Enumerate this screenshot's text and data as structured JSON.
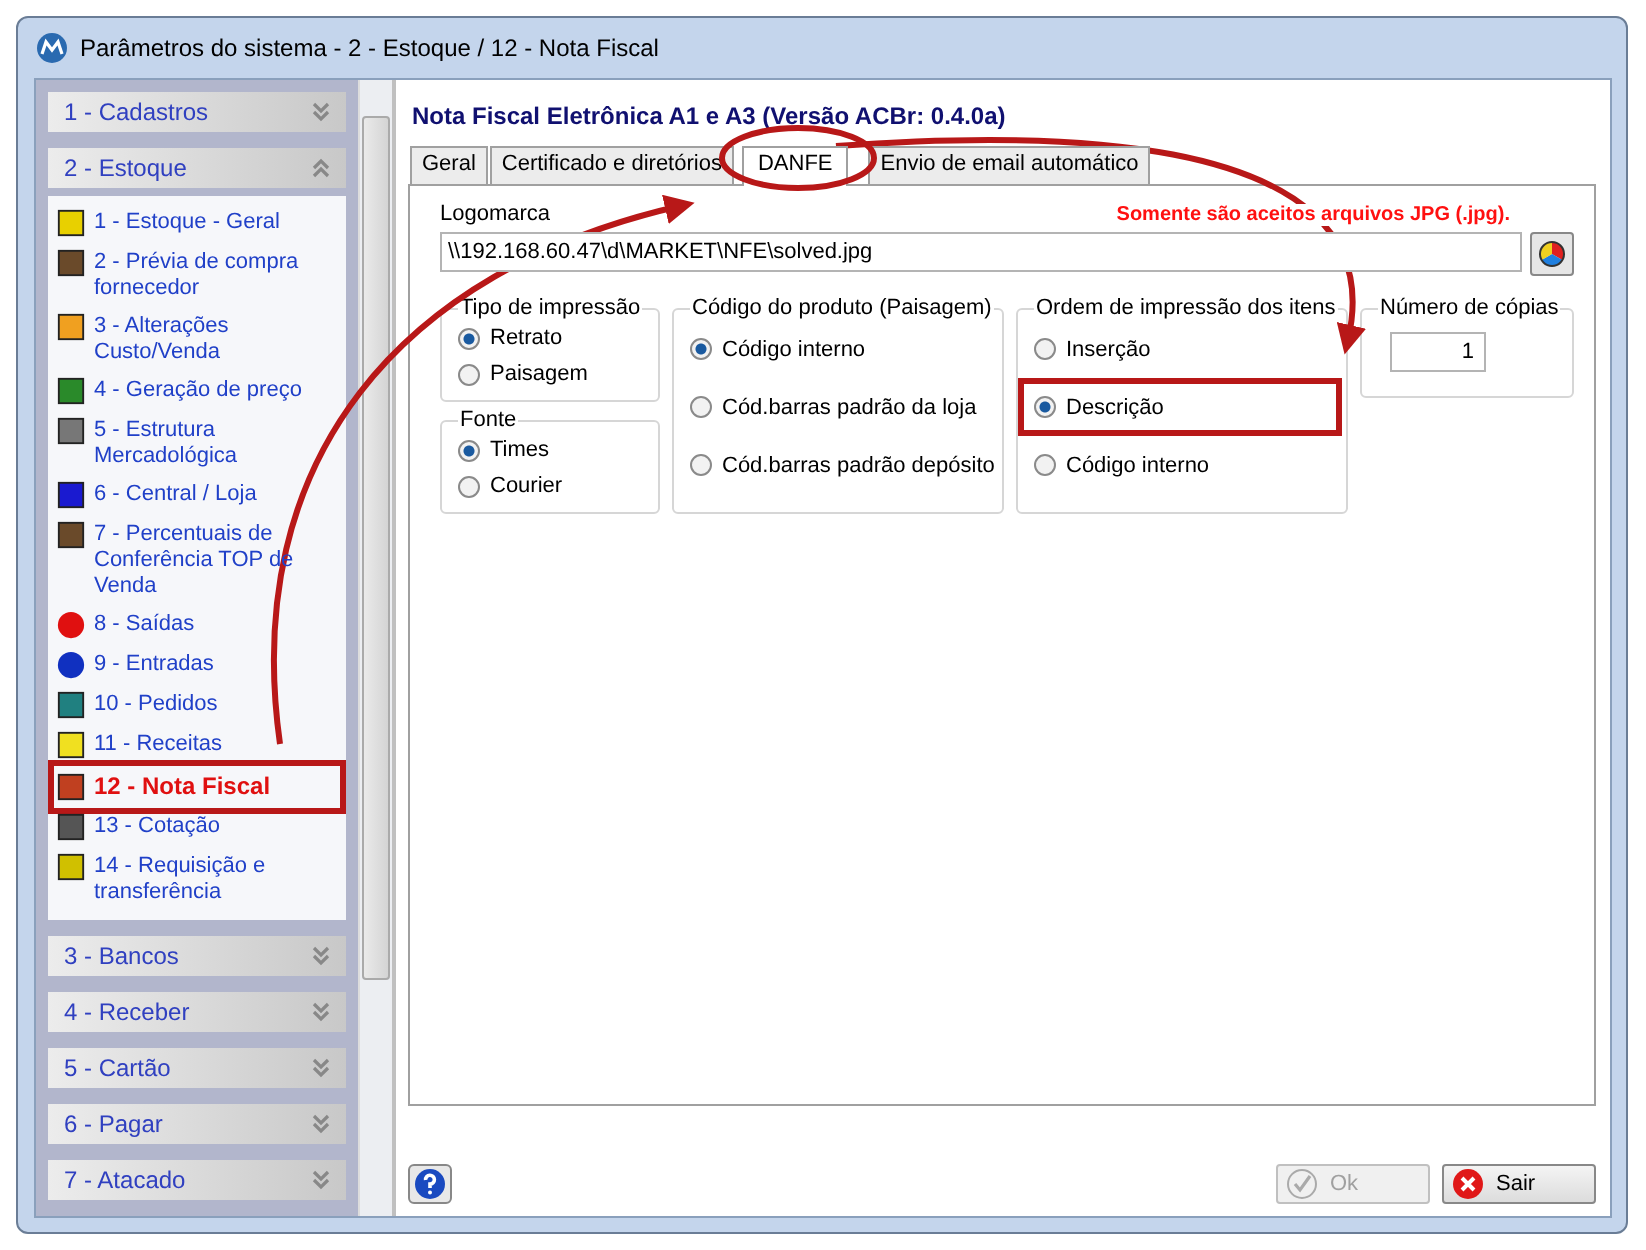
{
  "window": {
    "title": "Parâmetros do sistema - 2 - Estoque / 12 - Nota Fiscal"
  },
  "sidebar": {
    "groups": [
      {
        "label": "1 - Cadastros",
        "expanded": false
      },
      {
        "label": "2 - Estoque",
        "expanded": true,
        "items": [
          {
            "label": "1 - Estoque - Geral",
            "selected": false
          },
          {
            "label": "2 - Prévia de compra fornecedor",
            "selected": false
          },
          {
            "label": "3 - Alterações Custo/Venda",
            "selected": false
          },
          {
            "label": "4 - Geração de preço",
            "selected": false
          },
          {
            "label": "5 - Estrutura Mercadológica",
            "selected": false
          },
          {
            "label": "6 - Central / Loja",
            "selected": false
          },
          {
            "label": "7 - Percentuais de Conferência TOP de Venda",
            "selected": false
          },
          {
            "label": "8 - Saídas",
            "selected": false
          },
          {
            "label": "9 - Entradas",
            "selected": false
          },
          {
            "label": "10 - Pedidos",
            "selected": false
          },
          {
            "label": "11 - Receitas",
            "selected": false
          },
          {
            "label": "12 - Nota Fiscal",
            "selected": true
          },
          {
            "label": "13 - Cotação",
            "selected": false
          },
          {
            "label": "14 - Requisição e transferência",
            "selected": false
          }
        ]
      },
      {
        "label": "3 - Bancos",
        "expanded": false
      },
      {
        "label": "4 - Receber",
        "expanded": false
      },
      {
        "label": "5 - Cartão",
        "expanded": false
      },
      {
        "label": "6 - Pagar",
        "expanded": false
      },
      {
        "label": "7 - Atacado",
        "expanded": false
      }
    ]
  },
  "heading": "Nota Fiscal Eletrônica A1 e A3 (Versão ACBr: 0.4.0a)",
  "tabs": [
    {
      "label": "Geral",
      "selected": false
    },
    {
      "label": "Certificado e diretórios",
      "selected": false
    },
    {
      "label": "DANFE",
      "selected": true
    },
    {
      "label": "Envio de email automático",
      "selected": false
    }
  ],
  "logo": {
    "label": "Logomarca",
    "note": "Somente são aceitos arquivos JPG (.jpg).",
    "value": "\\\\192.168.60.47\\d\\MARKET\\NFE\\solved.jpg"
  },
  "print_type": {
    "title": "Tipo de impressão",
    "options": [
      {
        "label": "Retrato",
        "selected": true
      },
      {
        "label": "Paisagem",
        "selected": false
      }
    ]
  },
  "font": {
    "title": "Fonte",
    "options": [
      {
        "label": "Times",
        "selected": true
      },
      {
        "label": "Courier",
        "selected": false
      }
    ]
  },
  "product_code": {
    "title": "Código do produto (Paisagem)",
    "options": [
      {
        "label": "Código interno",
        "selected": true
      },
      {
        "label": "Cód.barras padrão da loja",
        "selected": false
      },
      {
        "label": "Cód.barras padrão depósito",
        "selected": false
      }
    ]
  },
  "item_order": {
    "title": "Ordem de impressão dos itens",
    "options": [
      {
        "label": "Inserção",
        "selected": false
      },
      {
        "label": "Descrição",
        "selected": true
      },
      {
        "label": "Código interno",
        "selected": false
      }
    ]
  },
  "copies": {
    "title": "Número de cópias",
    "value": "1"
  },
  "buttons": {
    "ok": {
      "label": "Ok",
      "disabled": true
    },
    "exit": {
      "label": "Sair",
      "disabled": false
    }
  }
}
